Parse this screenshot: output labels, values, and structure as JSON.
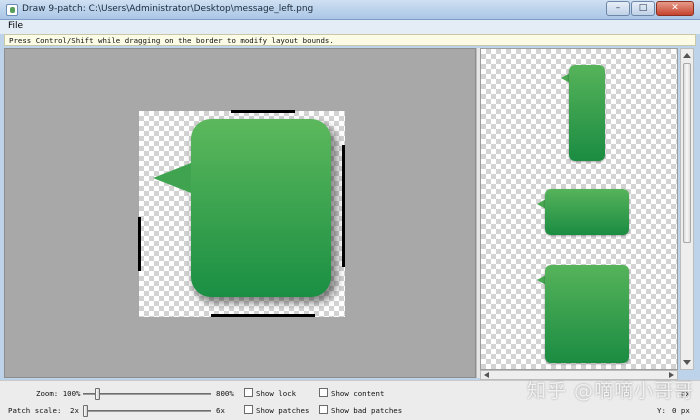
{
  "window": {
    "title": "Draw 9-patch: C:\\Users\\Administrator\\Desktop\\message_left.png",
    "minimize_icon": "minimize-icon",
    "maximize_icon": "maximize-icon",
    "close_icon": "close-icon"
  },
  "menu": {
    "file": "File"
  },
  "hint": "Press Control/Shift while dragging on the border to modify layout bounds.",
  "controls": {
    "zoom_label": "Zoom: 100%",
    "zoom_max": "800%",
    "zoom_level": 0.1,
    "patch_scale_label": "Patch scale:",
    "patch_scale_min": "2x",
    "patch_scale_max": "6x",
    "patch_scale_level": 0.0,
    "show_lock": "Show lock",
    "show_content": "Show content",
    "show_patches": "Show patches",
    "show_bad_patches": "Show bad patches",
    "show_lock_checked": false,
    "show_content_checked": false,
    "show_patches_checked": false,
    "show_bad_patches_checked": false,
    "x_label": "px",
    "y_label": "Y:",
    "y_value": "0 px"
  },
  "watermark": "知乎 @嘀嘀小哥哥",
  "colors": {
    "bubble_top": "#5cb85c",
    "bubble_bottom": "#1a8f43",
    "editor_bg": "#a8a8a8"
  }
}
